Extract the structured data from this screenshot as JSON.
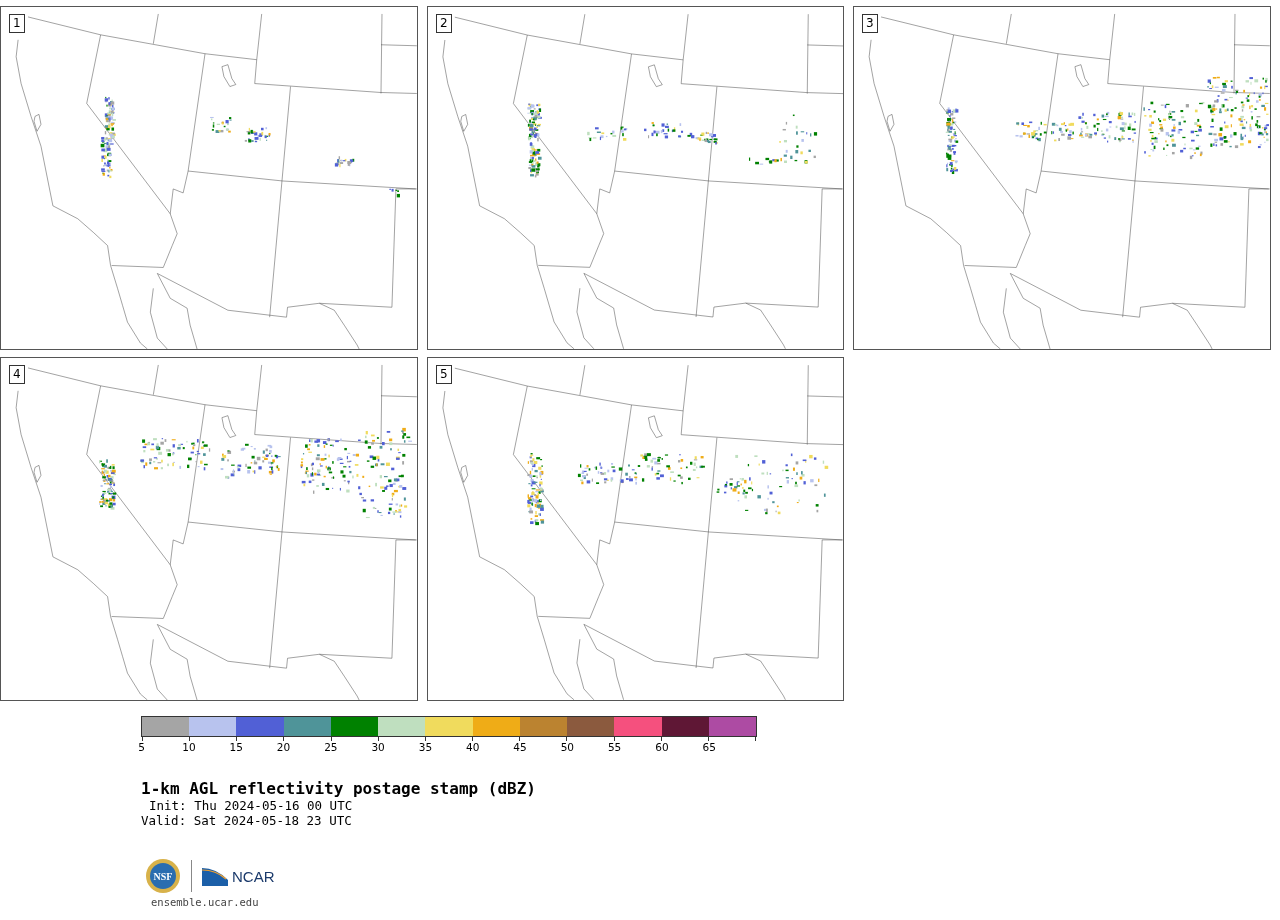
{
  "panels": [
    {
      "label": "1"
    },
    {
      "label": "2"
    },
    {
      "label": "3"
    },
    {
      "label": "4"
    },
    {
      "label": "5"
    }
  ],
  "colorbar": {
    "segments": [
      {
        "color": "#a5a5a5"
      },
      {
        "color": "#b8c3ee"
      },
      {
        "color": "#5160d6"
      },
      {
        "color": "#4f9499"
      },
      {
        "color": "#008100"
      },
      {
        "color": "#bfdfbf"
      },
      {
        "color": "#f0db5d"
      },
      {
        "color": "#efac17"
      },
      {
        "color": "#bb8330"
      },
      {
        "color": "#8b5a3e"
      },
      {
        "color": "#f5507e"
      },
      {
        "color": "#5f1735"
      },
      {
        "color": "#ad4ba3"
      }
    ],
    "ticks": [
      "5",
      "10",
      "15",
      "20",
      "25",
      "30",
      "35",
      "40",
      "45",
      "50",
      "55",
      "60",
      "65"
    ]
  },
  "title": "1-km AGL reflectivity postage stamp (dBZ)",
  "init": "Init: Thu 2024-05-16 00 UTC",
  "valid": "Valid: Sat 2024-05-18 23 UTC",
  "logo": {
    "nsf": "NSF",
    "ncar": "NCAR"
  },
  "website": "ensemble.ucar.edu"
}
